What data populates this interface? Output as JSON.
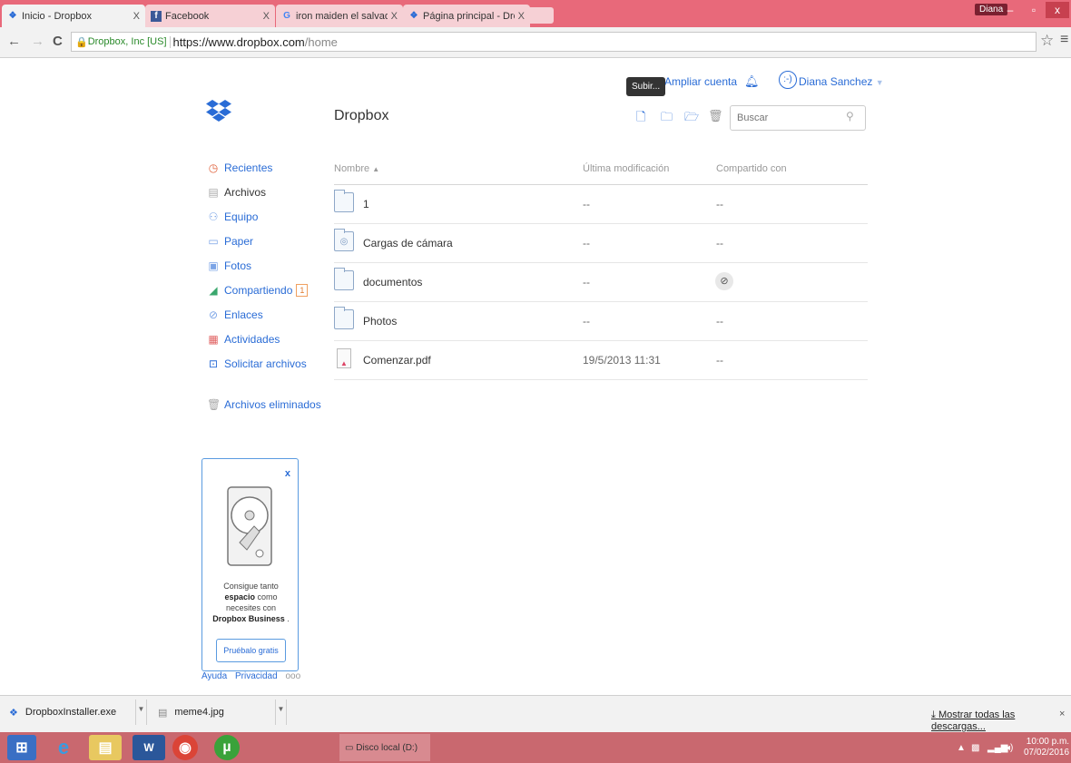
{
  "browser": {
    "tabs": [
      {
        "label": "Inicio - Dropbox",
        "favicon": "dropbox-icon",
        "active": true
      },
      {
        "label": "Facebook",
        "favicon": "facebook-icon",
        "active": false
      },
      {
        "label": "iron maiden el salvador - |",
        "favicon": "google-icon",
        "active": false
      },
      {
        "label": "Página principal - Dropbo",
        "favicon": "dropbox-icon",
        "active": false
      }
    ],
    "tab_close_glyph": "X",
    "profile": "Diana",
    "url_security": "Dropbox, Inc [US]",
    "url_host": "https://www.dropbox.com",
    "url_path": "/home"
  },
  "header": {
    "title": "Dropbox",
    "upgrade": "Ampliar cuenta",
    "user": "Diana Sanchez",
    "tooltip": "Subir...",
    "search_placeholder": "Buscar"
  },
  "sidebar": {
    "items": [
      {
        "label": "Recientes",
        "icon": "clock-icon"
      },
      {
        "label": "Archivos",
        "icon": "file-icon",
        "active": true
      },
      {
        "label": "Equipo",
        "icon": "team-icon"
      },
      {
        "label": "Paper",
        "icon": "paper-icon"
      },
      {
        "label": "Fotos",
        "icon": "photo-icon"
      },
      {
        "label": "Compartiendo",
        "icon": "sharing-icon",
        "badge": "1"
      },
      {
        "label": "Enlaces",
        "icon": "link-icon"
      },
      {
        "label": "Actividades",
        "icon": "calendar-icon"
      },
      {
        "label": "Solicitar archivos",
        "icon": "request-icon"
      }
    ],
    "deleted": "Archivos eliminados"
  },
  "table": {
    "col_name": "Nombre",
    "sort_glyph": "▲",
    "col_modified": "Última modificación",
    "col_shared": "Compartido con",
    "rows": [
      {
        "name": "1",
        "modified": "--",
        "shared": "--",
        "type": "folder"
      },
      {
        "name": "Cargas de cámara",
        "modified": "--",
        "shared": "--",
        "type": "camera-folder"
      },
      {
        "name": "documentos",
        "modified": "--",
        "shared": "",
        "type": "folder"
      },
      {
        "name": "Photos",
        "modified": "--",
        "shared": "--",
        "type": "folder"
      },
      {
        "name": "Comenzar.pdf",
        "modified": "19/5/2013 11:31",
        "shared": "--",
        "type": "pdf"
      }
    ]
  },
  "promo": {
    "close": "x",
    "line1": "Consigue tanto",
    "bold1": "espacio",
    "line2": "como",
    "line3": "necesites con",
    "bold2": "Dropbox Business",
    "line4": ".",
    "button": "Pruébalo gratis"
  },
  "footer": {
    "help": "Ayuda",
    "privacy": "Privacidad",
    "more": "ooo"
  },
  "downloads": {
    "items": [
      "DropboxInstaller.exe",
      "meme4.jpg"
    ],
    "show_all": "Mostrar todas las descargas...",
    "close": "×"
  },
  "taskbar": {
    "jump_label": "Disco local (D:)",
    "time": "10:00 p.m.",
    "date": "07/02/2016"
  },
  "colors": {
    "accent": "#2a6cd6",
    "chrome_frame": "#e8697a",
    "taskbar": "#c9686f"
  }
}
